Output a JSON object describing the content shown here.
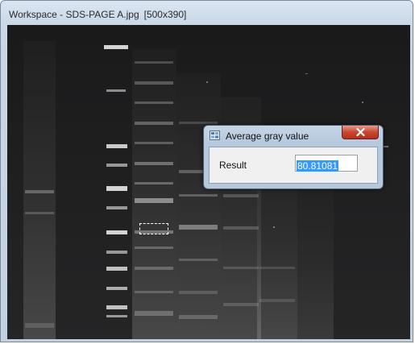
{
  "workspace": {
    "title": "Workspace - SDS-PAGE A.jpg",
    "dimensions": "[500x390]"
  },
  "image": {
    "name": "SDS-PAGE A.jpg",
    "icon": "gel-image"
  },
  "dialog": {
    "title": "Average gray value",
    "icon": "app-grid-icon",
    "close_icon": "close-icon",
    "result_label": "Result",
    "result_value": "80.81081",
    "result_selected": true
  },
  "colors": {
    "selection_highlight": "#3399ff",
    "close_button": "#c9462f",
    "window_frame": "#c2d1e2"
  }
}
